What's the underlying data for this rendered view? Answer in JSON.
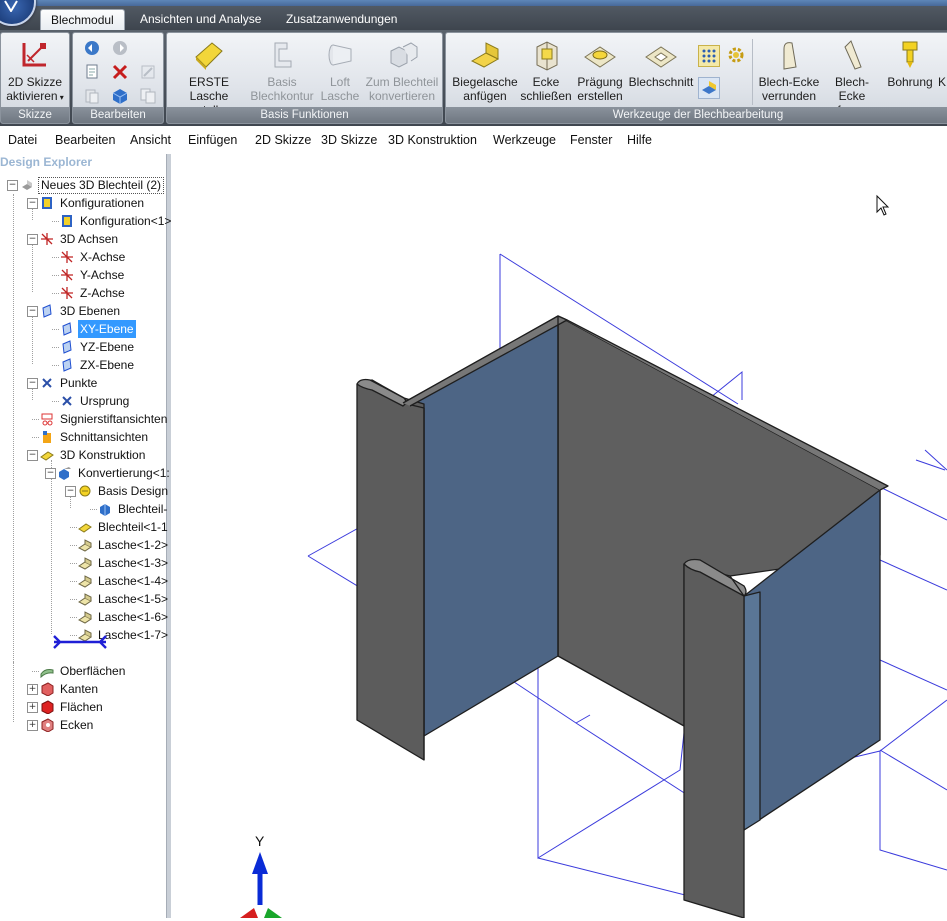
{
  "ribbon": {
    "tabs": [
      {
        "label": "Blechmodul",
        "active": true
      },
      {
        "label": "Ansichten und Analyse",
        "active": false
      },
      {
        "label": "Zusatzanwendungen",
        "active": false
      }
    ],
    "groups": {
      "skizze": "Skizze",
      "bearbeiten": "Bearbeiten",
      "basis": "Basis Funktionen",
      "werkzeuge": "Werkzeuge der Blechbearbeitung"
    },
    "buttons": {
      "skizze_line1": "2D Skizze",
      "skizze_line2": "aktivieren",
      "erste_line1": "ERSTE Lasche",
      "erste_line2": "erstellen",
      "basis_line1": "Basis",
      "basis_line2": "Blechkontur",
      "loft_line1": "Loft",
      "loft_line2": "Lasche",
      "zum_line1": "Zum Blechteil",
      "zum_line2": "konvertieren",
      "biege_line1": "Biegelasche",
      "biege_line2": "anfügen",
      "ecke_line1": "Ecke",
      "ecke_line2": "schließen",
      "praegung_line1": "Prägung",
      "praegung_line2": "erstellen",
      "blechschnitt": "Blechschnitt",
      "verrunden_line1": "Blech-Ecke",
      "verrunden_line2": "verrunden",
      "fasen_line1": "Blech-Ecke",
      "fasen_line2": "fasen",
      "bohrung": "Bohrung",
      "cut_off": "K"
    }
  },
  "menu": [
    "Datei",
    "Bearbeiten",
    "Ansicht",
    "Einfügen",
    "2D Skizze",
    "3D Skizze",
    "3D Konstruktion",
    "Werkzeuge",
    "Fenster",
    "Hilfe"
  ],
  "explorer": {
    "title": "Design Explorer",
    "nodes": [
      {
        "label": "Neues 3D Blechteil (2)"
      },
      {
        "label": "Konfigurationen"
      },
      {
        "label": "Konfiguration<1>"
      },
      {
        "label": "3D Achsen"
      },
      {
        "label": "X-Achse"
      },
      {
        "label": "Y-Achse"
      },
      {
        "label": "Z-Achse"
      },
      {
        "label": "3D Ebenen"
      },
      {
        "label": "XY-Ebene"
      },
      {
        "label": "YZ-Ebene"
      },
      {
        "label": "ZX-Ebene"
      },
      {
        "label": "Punkte"
      },
      {
        "label": "Ursprung"
      },
      {
        "label": "Signierstiftansichten"
      },
      {
        "label": "Schnittansichten"
      },
      {
        "label": "3D Konstruktion"
      },
      {
        "label": "Konvertierung<1:"
      },
      {
        "label": "Basis Design"
      },
      {
        "label": "Blechteil-"
      },
      {
        "label": "Blechteil<1-1"
      },
      {
        "label": "Lasche<1-2>"
      },
      {
        "label": "Lasche<1-3>"
      },
      {
        "label": "Lasche<1-4>"
      },
      {
        "label": "Lasche<1-5>"
      },
      {
        "label": "Lasche<1-6>"
      },
      {
        "label": "Lasche<1-7>"
      },
      {
        "label": "Oberflächen"
      },
      {
        "label": "Kanten"
      },
      {
        "label": "Flächen"
      },
      {
        "label": "Ecken"
      }
    ],
    "selected": "XY-Ebene"
  },
  "viewport": {
    "triad_label": "Y",
    "colors": {
      "plane_outline": "#3b3bdc",
      "sheet_grey": "#5f5f5f",
      "sheet_blue": "#4d6585"
    }
  },
  "icons": [
    "application-orb-icon",
    "sketch-2d-icon",
    "undo-icon",
    "redo-icon",
    "copy-icon",
    "delete-icon",
    "edit-icon",
    "paste-icon",
    "cube-icon",
    "duplicate-icon",
    "flange-icon",
    "base-contour-icon",
    "loft-icon",
    "convert-icon",
    "bend-flange-icon",
    "close-corner-icon",
    "emboss-icon",
    "sheet-cut-icon",
    "grid-pattern-icon",
    "gear-icon",
    "unfold-icon",
    "corner-round-icon",
    "corner-chamfer-icon",
    "hole-icon",
    "cursor-icon"
  ]
}
